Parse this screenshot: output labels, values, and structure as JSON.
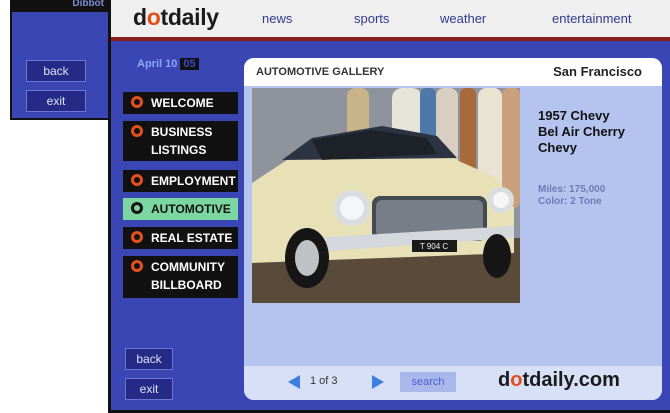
{
  "back_window": {
    "title_fragment": "Dibbot",
    "back_label": "back",
    "exit_label": "exit"
  },
  "header": {
    "logo": {
      "part1": "d",
      "o": "o",
      "part2": "tdaily"
    },
    "nav": [
      "news",
      "sports",
      "weather",
      "entertainment"
    ]
  },
  "date": {
    "text": "April 10",
    "year": "05"
  },
  "menu": [
    {
      "line1": "WELCOME",
      "line2": ""
    },
    {
      "line1": "BUSINESS",
      "line2": "LISTINGS"
    },
    {
      "line1": "EMPLOYMENT",
      "line2": ""
    },
    {
      "line1": "AUTOMOTIVE",
      "line2": ""
    },
    {
      "line1": "REAL ESTATE",
      "line2": ""
    },
    {
      "line1": "COMMUNITY",
      "line2": "BILLBOARD"
    }
  ],
  "side": {
    "back_label": "back",
    "exit_label": "exit"
  },
  "gallery": {
    "label": "AUTOMOTIVE GALLERY",
    "city": "San Francisco",
    "title_lines": [
      "1957 Chevy",
      "Bel Air Cherry",
      "Chevy"
    ],
    "miles": "Miles: 175,000",
    "color": "Color: 2 Tone",
    "plate": "T 904 C"
  },
  "footer": {
    "pager": "1 of 3",
    "search_label": "search",
    "logo": {
      "part1": "d",
      "o": "o",
      "part2": "tdaily.com"
    }
  },
  "colors": {
    "panel_blue": "#3b46b5",
    "accent_orange": "#e5501e",
    "active_green": "#7bd6a2",
    "arrow_blue": "#3f7fe0"
  }
}
